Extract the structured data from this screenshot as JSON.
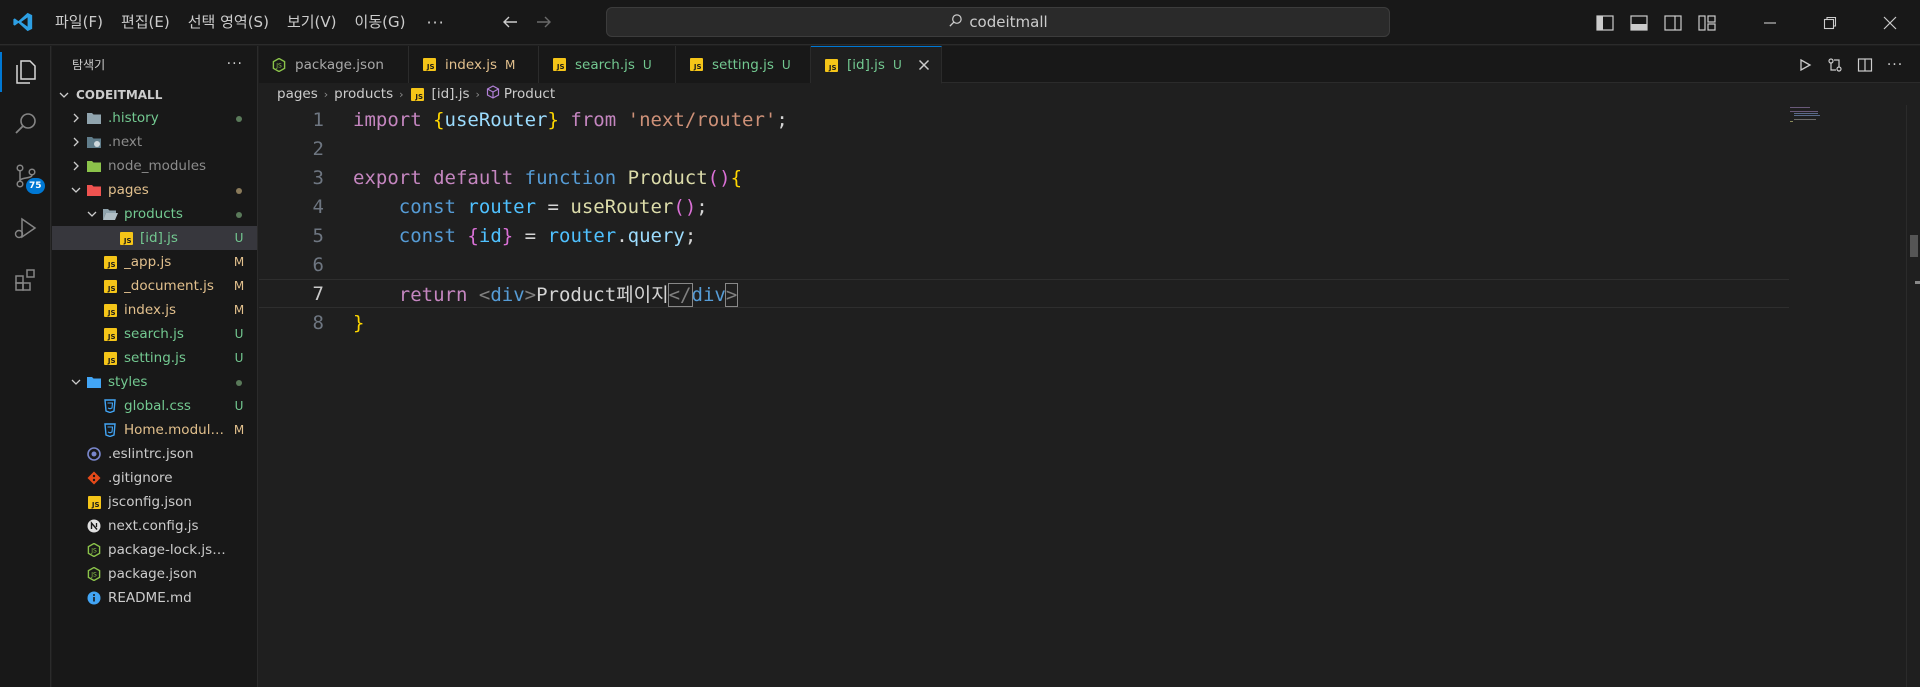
{
  "titlebar": {
    "menu": [
      "파일(F)",
      "편집(E)",
      "선택 영역(S)",
      "보기(V)",
      "이동(G)"
    ],
    "more": "···",
    "search_text": "codeitmall"
  },
  "activitybar": {
    "source_control_badge": "75"
  },
  "sidebar": {
    "title": "탐색기",
    "more": "···",
    "root": "CODEITMALL",
    "items": [
      {
        "name": ".history",
        "status": "dot"
      },
      {
        "name": ".next",
        "status": ""
      },
      {
        "name": "node_modules",
        "status": ""
      },
      {
        "name": "pages",
        "status": "dot"
      },
      {
        "name": "products",
        "status": "dot"
      },
      {
        "name": "[id].js",
        "status": "U"
      },
      {
        "name": "_app.js",
        "status": "M"
      },
      {
        "name": "_document.js",
        "status": "M"
      },
      {
        "name": "index.js",
        "status": "M"
      },
      {
        "name": "search.js",
        "status": "U"
      },
      {
        "name": "setting.js",
        "status": "U"
      },
      {
        "name": "styles",
        "status": "dot"
      },
      {
        "name": "global.css",
        "status": "U"
      },
      {
        "name": "Home.module.css",
        "status": "M"
      },
      {
        "name": ".eslintrc.json",
        "status": ""
      },
      {
        "name": ".gitignore",
        "status": ""
      },
      {
        "name": "jsconfig.json",
        "status": ""
      },
      {
        "name": "next.config.js",
        "status": ""
      },
      {
        "name": "package-lock.json",
        "status": ""
      },
      {
        "name": "package.json",
        "status": ""
      },
      {
        "name": "README.md",
        "status": ""
      }
    ]
  },
  "tabs": [
    {
      "name": "package.json",
      "status": ""
    },
    {
      "name": "index.js",
      "status": "M"
    },
    {
      "name": "search.js",
      "status": "U"
    },
    {
      "name": "setting.js",
      "status": "U"
    },
    {
      "name": "[id].js",
      "status": "U"
    }
  ],
  "breadcrumb": [
    "pages",
    "products",
    "[id].js",
    "Product"
  ],
  "code": {
    "line_numbers": [
      "1",
      "2",
      "3",
      "4",
      "5",
      "6",
      "7",
      "8"
    ],
    "l1": {
      "import": "import",
      "ob": "{",
      "id": "useRouter",
      "cb": "}",
      "from": "from",
      "str": "'next/router'",
      "semi": ";"
    },
    "l3": {
      "export": "export",
      "default": "default",
      "function": "function",
      "name": "Product",
      "parens": "()",
      "brace": "{"
    },
    "l4": {
      "const": "const",
      "var": "router",
      "eq": "=",
      "fn": "useRouter",
      "parens": "()",
      "semi": ";"
    },
    "l5": {
      "const": "const",
      "ob": "{",
      "id": "id",
      "cb": "}",
      "eq": "=",
      "obj": "router",
      "dot": ".",
      "prop": "query",
      "semi": ";"
    },
    "l7": {
      "return": "return",
      "lt1": "<",
      "tag1": "div",
      "gt1": ">",
      "text": "Product페이지",
      "lt2": "</",
      "tag2": "div",
      "gt2": ">"
    },
    "l8": {
      "brace": "}"
    }
  },
  "colors": {
    "accent": "#0078d4",
    "modified": "#e2c08d",
    "untracked": "#73c991",
    "js_icon": "#f5c518"
  }
}
